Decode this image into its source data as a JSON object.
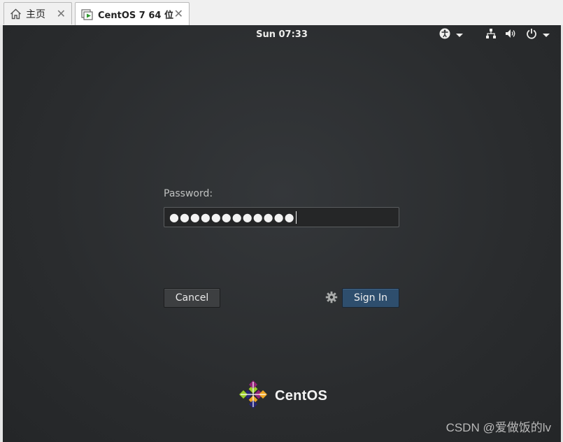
{
  "tabs": [
    {
      "label": "主页",
      "icon": "home-icon"
    },
    {
      "label": "CentOS 7 64 位",
      "icon": "vm-icon",
      "active": true
    }
  ],
  "topbar": {
    "clock": "Sun 07:33",
    "icons": [
      "accessibility-icon",
      "network-icon",
      "volume-icon",
      "power-icon"
    ]
  },
  "login": {
    "password_label": "Password:",
    "password_value": "●●●●●●●●●●●●",
    "cancel_label": "Cancel",
    "signin_label": "Sign In"
  },
  "brand": {
    "logo_text": "CentOS"
  },
  "watermark": "CSDN @爱做饭的lv",
  "colors": {
    "background": "#2b2d2f",
    "signin_button": "#2e4e6d",
    "cancel_button": "#3d3f41",
    "text": "#eeeeec"
  }
}
